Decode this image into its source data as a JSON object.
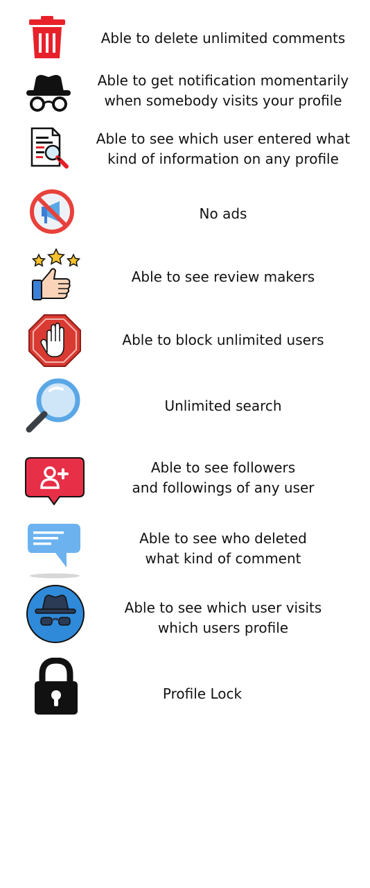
{
  "features": [
    {
      "icon": "trash-icon",
      "lines": [
        "Able to delete unlimited comments"
      ]
    },
    {
      "icon": "incognito-hat-glasses-icon",
      "lines": [
        "Able to get notification momentarily",
        "when somebody visits your profile"
      ]
    },
    {
      "icon": "document-magnifier-icon",
      "lines": [
        "Able to see which user entered what",
        "kind of information on any profile"
      ]
    },
    {
      "icon": "no-ads-icon",
      "lines": [
        "No ads"
      ]
    },
    {
      "icon": "thumbs-up-stars-icon",
      "lines": [
        "Able to see review makers"
      ]
    },
    {
      "icon": "stop-hand-icon",
      "lines": [
        "Able to block unlimited users"
      ]
    },
    {
      "icon": "magnifier-icon",
      "lines": [
        "Unlimited search"
      ]
    },
    {
      "icon": "add-follower-icon",
      "lines": [
        "Able to see followers",
        "and followings of any user"
      ]
    },
    {
      "icon": "comment-bubble-icon",
      "lines": [
        "Able to see who deleted",
        "what kind of comment"
      ]
    },
    {
      "icon": "incognito-circle-icon",
      "lines": [
        "Able to see which user visits",
        "which users profile"
      ]
    },
    {
      "icon": "padlock-icon",
      "lines": [
        "Profile Lock"
      ]
    }
  ],
  "colors": {
    "trash_red": "#e8202a",
    "no_ads_red": "#e8413b",
    "stop_red": "#d93a32",
    "follower_red": "#e72f48",
    "magnifier_blue": "#5aa7e6",
    "bubble_blue": "#6bb2ef",
    "incognito_blue": "#2f8ad9",
    "star_yellow": "#f7c32f",
    "text": "#111111"
  }
}
